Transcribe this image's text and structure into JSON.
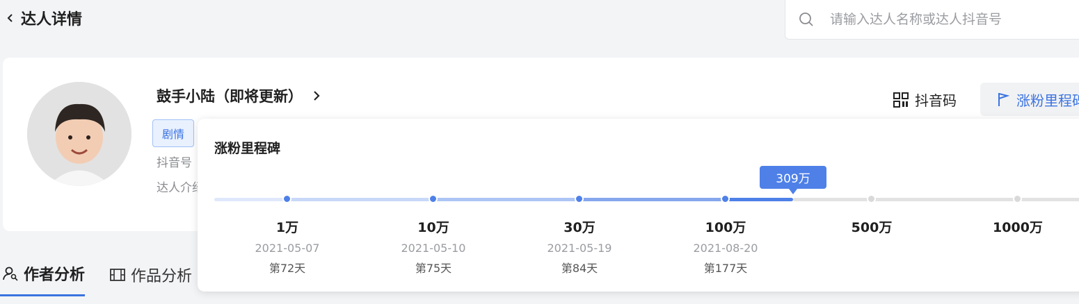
{
  "header": {
    "title": "达人详情",
    "search_placeholder": "请输入达人名称或达人抖音号"
  },
  "profile": {
    "name": "鼓手小陆（即将更新）",
    "tag": "剧情",
    "douyin_id_label": "抖音号",
    "intro_label": "达人介绍",
    "qr_label": "抖音码",
    "milestone_button_label": "涨粉里程碑"
  },
  "tabs": [
    {
      "label": "作者分析",
      "active": true
    },
    {
      "label": "作品分析",
      "active": false
    }
  ],
  "popover": {
    "title": "涨粉里程碑",
    "current_fans": "309万",
    "progress_color": "#4e80e8",
    "milestones": [
      {
        "label": "1万",
        "date": "2021-05-07",
        "day": "第72天",
        "reached": true
      },
      {
        "label": "10万",
        "date": "2021-05-10",
        "day": "第75天",
        "reached": true
      },
      {
        "label": "30万",
        "date": "2021-05-19",
        "day": "第84天",
        "reached": true
      },
      {
        "label": "100万",
        "date": "2021-08-20",
        "day": "第177天",
        "reached": true
      },
      {
        "label": "500万",
        "date": "",
        "day": "",
        "reached": false
      },
      {
        "label": "1000万",
        "date": "",
        "day": "",
        "reached": false
      }
    ]
  }
}
